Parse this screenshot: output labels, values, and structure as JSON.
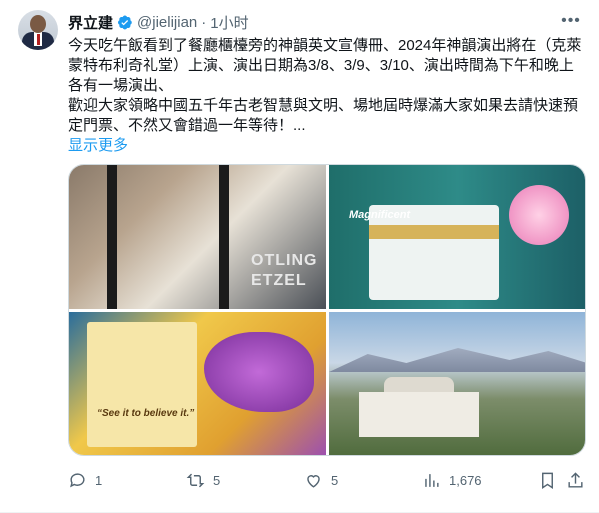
{
  "tweet": {
    "author_name": "界立建",
    "handle": "@jielijian",
    "separator": "·",
    "time": "1小时",
    "text": "今天吃午飯看到了餐廳櫃檯旁的神韻英文宣傳冊、2024年神韻演出將在（克萊蒙特布利奇礼堂）上演、演出日期為3/8、3/9、3/10、演出時間為下午和晚上各有一場演出、\n歡迎大家領略中國五千年古老智慧與文明、場地屆時爆滿大家如果去請快速預定門票、不然又會錯過一年等待！...",
    "show_more": "显示更多",
    "media": {
      "photo1_sign": "OTLING\nETZEL",
      "photo2_caption": "Magnificent",
      "photo3_quote": "“See it to believe it.”"
    },
    "actions": {
      "reply_count": "1",
      "repost_count": "5",
      "like_count": "5",
      "views_count": "1,676"
    },
    "colors": {
      "accent": "#1d9bf0",
      "secondary_text": "#536471",
      "primary_text": "#0f1419"
    }
  }
}
